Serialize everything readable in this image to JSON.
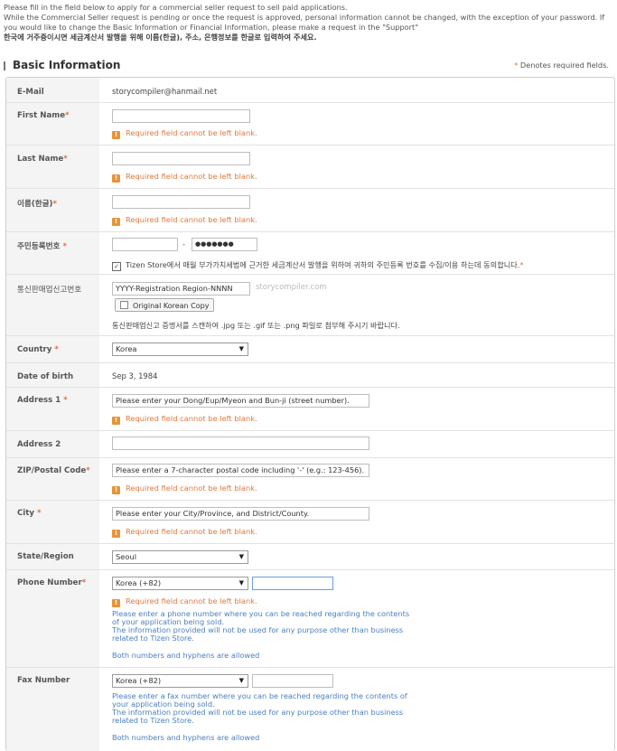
{
  "intro": {
    "line1": "Please fill in the field below to apply for a commercial seller request to sell paid applications.",
    "line2": "While the Commercial Seller request is pending or once the request is approved, personal information cannot be changed, with the exception of your password. If you would like to change the Basic Information or Financial Information, please make a request in the \"Support\"",
    "line3": "한국에 거주중이시면 세금계산서 발행을 위해 이름(한글), 주소, 은행정보를 한글로 입력하여 주세요."
  },
  "section": {
    "title": "Basic Information",
    "required_note": "Denotes required fields.",
    "required_star": "*"
  },
  "fields": {
    "email": {
      "label": "E-Mail",
      "value": "storycompiler@hanmail.net"
    },
    "first_name": {
      "label": "First Name",
      "value": "",
      "error": "Required field cannot be left blank."
    },
    "last_name": {
      "label": "Last Name",
      "value": "",
      "error": "Required field cannot be left blank."
    },
    "korean_name": {
      "label": "이름(한글)",
      "value": "",
      "error": "Required field cannot be left blank."
    },
    "resident_no": {
      "label": "주민등록번호",
      "first": "",
      "dash": "-",
      "second": "●●●●●●●",
      "consent": "Tizen Store에서 매월 부가가치세법에 근거한 세금계산서 발행을 위하여 귀하의 주민등록 번호를 수집/이용 하는데 동의합니다.",
      "consent_star": "*"
    },
    "mail_order": {
      "label": "통신판매업신고번호",
      "placeholder": "YYYY-Registration Region-NNNN",
      "watermark": "storycompiler.com",
      "button": "Original Korean Copy",
      "note": "통신판매업신고 증명서를 스캔하여 .jpg 또는 .gif 또는 .png 파일로 첨부해 주시기 바랍니다."
    },
    "country": {
      "label": "Country",
      "value": "Korea"
    },
    "dob": {
      "label": "Date of birth",
      "value": "Sep 3, 1984"
    },
    "address1": {
      "label": "Address 1",
      "placeholder": "Please enter your Dong/Eup/Myeon and Bun-ji (street number).",
      "error": "Required field cannot be left blank."
    },
    "address2": {
      "label": "Address 2",
      "value": ""
    },
    "zip": {
      "label": "ZIP/Postal Code",
      "placeholder": "Please enter a 7-character postal code including '-' (e.g.: 123-456).",
      "error": "Required field cannot be left blank."
    },
    "city": {
      "label": "City",
      "placeholder": "Please enter your City/Province, and District/County.",
      "error": "Required field cannot be left blank."
    },
    "state": {
      "label": "State/Region",
      "value": "Seoul"
    },
    "phone": {
      "label": "Phone Number",
      "country_code": "Korea (+82)",
      "value": "",
      "error": "Required field cannot be left blank.",
      "help1": "Please enter a phone number where you can be reached regarding the contents of your application being sold.",
      "help2": "The information provided will not be used for any purpose other than business related to Tizen Store.",
      "help3": "Both numbers and hyphens are allowed"
    },
    "fax": {
      "label": "Fax Number",
      "country_code": "Korea (+82)",
      "value": "",
      "help1": "Please enter a fax number where you can be reached regarding the contents of your application being sold.",
      "help2": "The information provided will not be used for any purpose other than business related to Tizen Store.",
      "help3": "Both numbers and hyphens are allowed"
    }
  },
  "icons": {
    "error": "warning-icon",
    "select": "chevron-down-icon",
    "check": "checkbox-icon"
  },
  "colors": {
    "required": "#e07040",
    "error": "#e0783a",
    "help": "#4a7fc1",
    "label_bg": "#f4f4f4",
    "focus": "#6a9fd8"
  }
}
